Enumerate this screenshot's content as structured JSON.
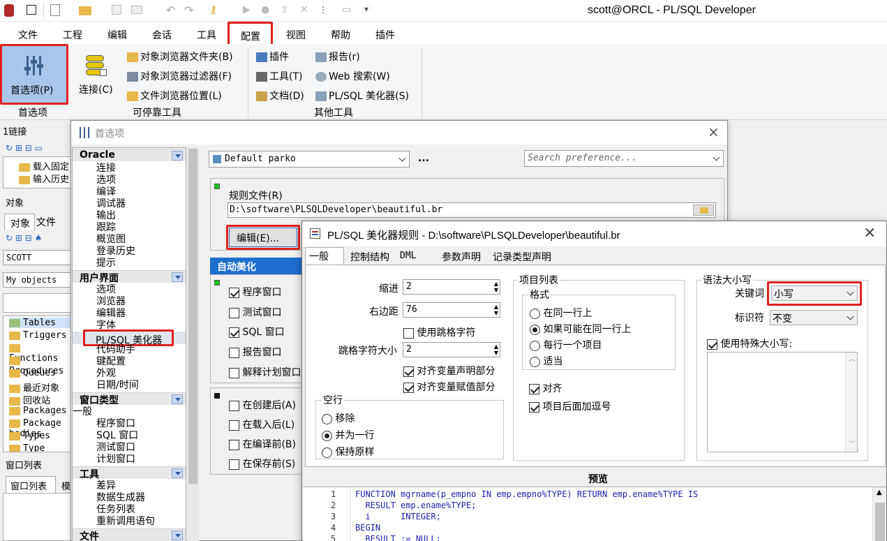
{
  "app": {
    "title": "scott@ORCL - PL/SQL Developer"
  },
  "menu": [
    "文件",
    "工程",
    "编辑",
    "会话",
    "工具",
    "配置",
    "视图",
    "帮助",
    "插件"
  ],
  "ribbon": {
    "preferences_label": "首选项(P)",
    "preferences_group": "首选项",
    "connect_label": "连接(C)",
    "dockable": [
      "对象浏览器文件夹(B)",
      "对象浏览器过滤器(F)",
      "文件浏览器位置(L)"
    ],
    "dockable_group": "可停靠工具",
    "other_left": [
      "插件",
      "工具(T)",
      "文档(D)"
    ],
    "other_right": [
      "报告(r)",
      "Web 搜索(W)",
      "PL/SQL 美化器(S)"
    ],
    "other_group": "其他工具"
  },
  "left_panel": {
    "connections_header": "1链接",
    "conn_items": [
      "载入固定",
      "输入历史",
      "最近"
    ],
    "objects_header": "对象",
    "tabs": [
      "对象",
      "文件"
    ],
    "user": "SCOTT",
    "filter": "My objects",
    "tree": [
      "Tables",
      "Triggers",
      "Functions",
      "Procedures",
      "Queues",
      "最近对象",
      "回收站",
      "Packages",
      "Package bodies",
      "Types",
      "Type bodies"
    ],
    "window_list_header": "窗口列表",
    "bottom_tabs": [
      "窗口列表",
      "模"
    ]
  },
  "prefs": {
    "title": "首选项",
    "close": "×",
    "profile": "Default parko",
    "ellipsis": "...",
    "search_placeholder": "Search preference...",
    "categories": [
      {
        "name": "Oracle",
        "items": [
          "连接",
          "选项",
          "编译",
          "调试器",
          "输出",
          "跟踪",
          "概览图",
          "登录历史",
          "提示"
        ]
      },
      {
        "name": "用户界面",
        "items": [
          "选项",
          "浏览器",
          "编辑器",
          "字体",
          "PL/SQL 美化器",
          "代码助手",
          "键配置",
          "外观",
          "日期/时间"
        ]
      },
      {
        "name": "窗口类型",
        "items": [
          "一般",
          "程序窗口",
          "SQL 窗口",
          "测试窗口",
          "计划窗口"
        ]
      },
      {
        "name": "工具",
        "items": [
          "差异",
          "数据生成器",
          "任务列表",
          "重新调用语句"
        ]
      },
      {
        "name": "文件",
        "items": []
      }
    ],
    "rules_file_label": "规则文件(R)",
    "rules_file_value": "D:\\software\\PLSQLDeveloper\\beautiful.br",
    "edit_button": "编辑(E)...",
    "auto_beautify": "自动美化",
    "auto_list": [
      "程序窗口",
      "测试窗口",
      "SQL 窗口",
      "报告窗口",
      "解释计划窗口"
    ],
    "when_list": [
      "在创建后(A)",
      "在载入后(L)",
      "在编译前(B)",
      "在保存前(S)"
    ]
  },
  "rules": {
    "title": "PL/SQL 美化器规则 - D:\\software\\PLSQLDeveloper\\beautiful.br",
    "close": "×",
    "tabs": [
      "一般",
      "控制结构",
      "DML",
      "参数声明",
      "记录类型声明"
    ],
    "indent_label": "缩进",
    "indent_value": "2",
    "right_margin_label": "右边距",
    "right_margin_value": "76",
    "use_tab_label": "使用跳格字符",
    "tab_size_label": "跳格字符大小",
    "tab_size_value": "2",
    "align_decl": "对齐变量声明部分",
    "align_assign": "对齐变量赋值部分",
    "blank_lines_label": "空行",
    "blank_options": [
      "移除",
      "并为一行",
      "保持原样"
    ],
    "item_list_label": "项目列表",
    "format_label": "格式",
    "format_options": [
      "在同一行上",
      "如果可能在同一行上",
      "每行一个项目",
      "适当"
    ],
    "align_label": "对齐",
    "comma_after": "项目后面加逗号",
    "case_label": "语法大小写",
    "keyword_label": "关键词",
    "keyword_value": "小写",
    "identifier_label": "标识符",
    "identifier_value": "不变",
    "special_case_label": "使用特殊大小写:",
    "preview_label": "预览",
    "preview_lines": [
      {
        "n": "1",
        "code": "FUNCTION mgrname(p_empno IN emp.empno%TYPE) RETURN emp.ename%TYPE IS"
      },
      {
        "n": "2",
        "code": "  RESULT emp.ename%TYPE;"
      },
      {
        "n": "3",
        "code": "  i      INTEGER;"
      },
      {
        "n": "4",
        "code": "BEGIN"
      },
      {
        "n": "5",
        "code": "  RESULT := NULL;"
      }
    ]
  }
}
